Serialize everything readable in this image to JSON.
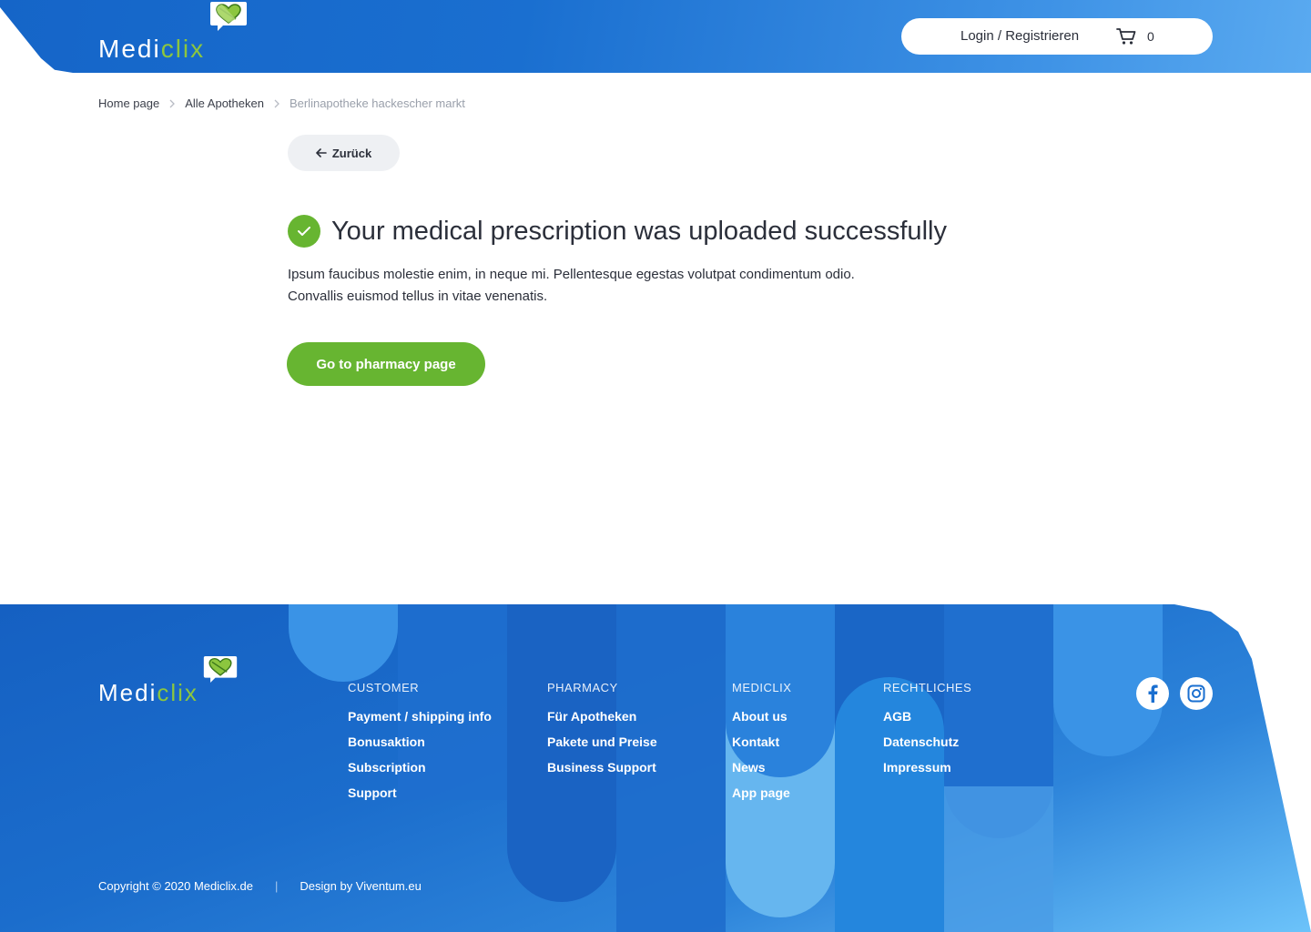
{
  "brand": {
    "name_part1": "Medi",
    "name_part2": "clix",
    "accent_color": "#8cc63f",
    "primary_blue": "#1565c8"
  },
  "header": {
    "login_label": "Login / Registrieren",
    "cart_icon": "shopping-cart-icon",
    "cart_count": "0"
  },
  "breadcrumb": {
    "items": [
      "Home page",
      "Alle Apotheken",
      "Berlinapotheke hackescher markt"
    ]
  },
  "back_button": {
    "label": "Zurück",
    "icon": "arrow-left-icon"
  },
  "success": {
    "icon": "check-circle-icon",
    "title": "Your medical prescription was uploaded successfully",
    "description_lines": [
      "Ipsum faucibus molestie enim, in neque mi. Pellentesque egestas volutpat condimentum odio.",
      "Convallis euismod tellus in vitae venenatis."
    ],
    "color": "#67b531"
  },
  "primary_button": {
    "label": "Go to pharmacy page"
  },
  "footer": {
    "columns": [
      {
        "title": "CUSTOMER",
        "links": [
          "Payment / shipping info",
          "Bonusaktion",
          "Subscription",
          "Support"
        ]
      },
      {
        "title": "PHARMACY",
        "links": [
          "Für Apotheken",
          "Pakete und Preise",
          "Business Support"
        ]
      },
      {
        "title": "MEDICLIX",
        "links": [
          "About us",
          "Kontakt",
          "News",
          "App page"
        ]
      },
      {
        "title": "RECHTLICHES",
        "links": [
          "AGB",
          "Datenschutz",
          "Impressum"
        ]
      }
    ],
    "social": [
      "facebook-icon",
      "instagram-icon"
    ],
    "copyright": "Copyright © 2020 Mediclix.de",
    "divider": "|",
    "design_credit": "Design by Viventum.eu"
  }
}
